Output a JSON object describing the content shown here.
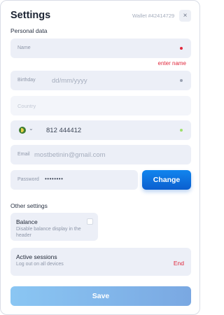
{
  "header": {
    "title": "Settings",
    "wallet_label": "Wallet #42414729",
    "close_icon": "×"
  },
  "personal": {
    "section_title": "Personal data",
    "name": {
      "label": "Name",
      "value": "",
      "error": "enter name"
    },
    "birthday": {
      "label": "Birthday",
      "placeholder": "dd/mm/yyyy"
    },
    "country": {
      "placeholder": "Country"
    },
    "phone": {
      "flag_icon": "flag-icon",
      "value": "812 444412"
    },
    "email": {
      "label": "Email",
      "value": "mostbetinin@gmail.com"
    },
    "password": {
      "label": "Password",
      "value": "••••••••",
      "change_label": "Change"
    }
  },
  "other": {
    "section_title": "Other settings",
    "balance": {
      "title": "Balance",
      "description": "Disable balance display in the header"
    },
    "sessions": {
      "title": "Active sessions",
      "description": "Log out on all devices",
      "end_label": "End"
    }
  },
  "footer": {
    "save_label": "Save"
  },
  "colors": {
    "accent": "#0b6fe0",
    "error": "#e0283c",
    "field_bg": "#eceff7",
    "valid": "#9ee06b",
    "neutral_dot": "#9aa2b1"
  }
}
